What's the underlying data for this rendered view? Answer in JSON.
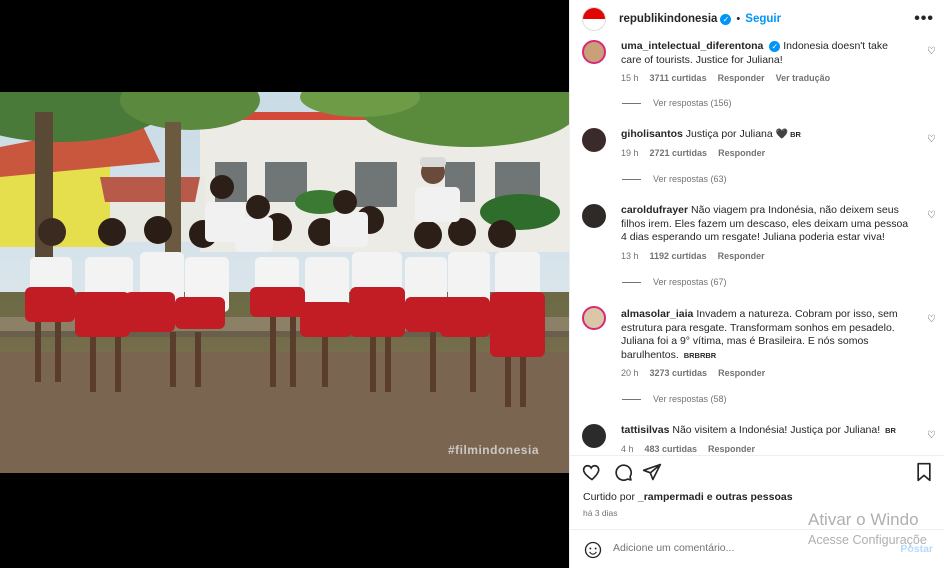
{
  "header": {
    "username": "republikindonesia",
    "separator": "•",
    "follow_label": "Seguir",
    "more_icon": "more-horizontal-icon"
  },
  "photo": {
    "watermark": "#filmindonesia"
  },
  "comments": [
    {
      "username": "uma_intelectual_diferentona",
      "verified": true,
      "text": "Indonesia doesn't take care of tourists. Justice for Juliana!",
      "time": "15 h",
      "likes": "3711 curtidas",
      "reply": "Responder",
      "translate": "Ver tradução",
      "view_replies": "Ver respostas (156)"
    },
    {
      "username": "giholisantos",
      "text": "Justiça por Juliana",
      "flag": "BR",
      "time": "19 h",
      "likes": "2721 curtidas",
      "reply": "Responder",
      "view_replies": "Ver respostas (63)"
    },
    {
      "username": "caroldufrayer",
      "text": "Não viagem pra Indonésia, não deixem seus filhos irem. Eles fazem um descaso, eles deixam uma pessoa 4 dias esperando um resgate! Juliana poderia estar viva!",
      "time": "13 h",
      "likes": "1192 curtidas",
      "reply": "Responder",
      "view_replies": "Ver respostas (67)"
    },
    {
      "username": "almasolar_iaia",
      "text": "Invadem a natureza. Cobram por isso, sem estrutura para resgate. Transformam sonhos em pesadelo. Juliana foi a 9° vítima, mas é Brasileira. E nós somos barulhentos.",
      "flag": "BRBRBR",
      "time": "20 h",
      "likes": "3273 curtidas",
      "reply": "Responder",
      "view_replies": "Ver respostas (58)"
    },
    {
      "username": "tattisilvas",
      "text": "Não visitem a Indonésia! Justiça por Juliana!",
      "flag": "BR",
      "time": "4 h",
      "likes": "483 curtidas",
      "reply": "Responder"
    }
  ],
  "footer": {
    "liked_prefix": "Curtido por",
    "liked_user": "_rampermadi",
    "liked_suffix": "e outras pessoas",
    "date": "há 3 dias",
    "comment_placeholder": "Adicione um comentário...",
    "post_label": "Postar"
  },
  "icons": {
    "like": "heart-icon",
    "comment": "comment-icon",
    "share": "share-icon",
    "save": "bookmark-icon",
    "emoji": "emoji-icon"
  },
  "watermark_os": {
    "line1": "Ativar o Windo",
    "line2": "Acesse Configuraçõe"
  },
  "colors": {
    "accent": "#0095f6",
    "muted": "#737373",
    "flag_red": "#e10600"
  }
}
